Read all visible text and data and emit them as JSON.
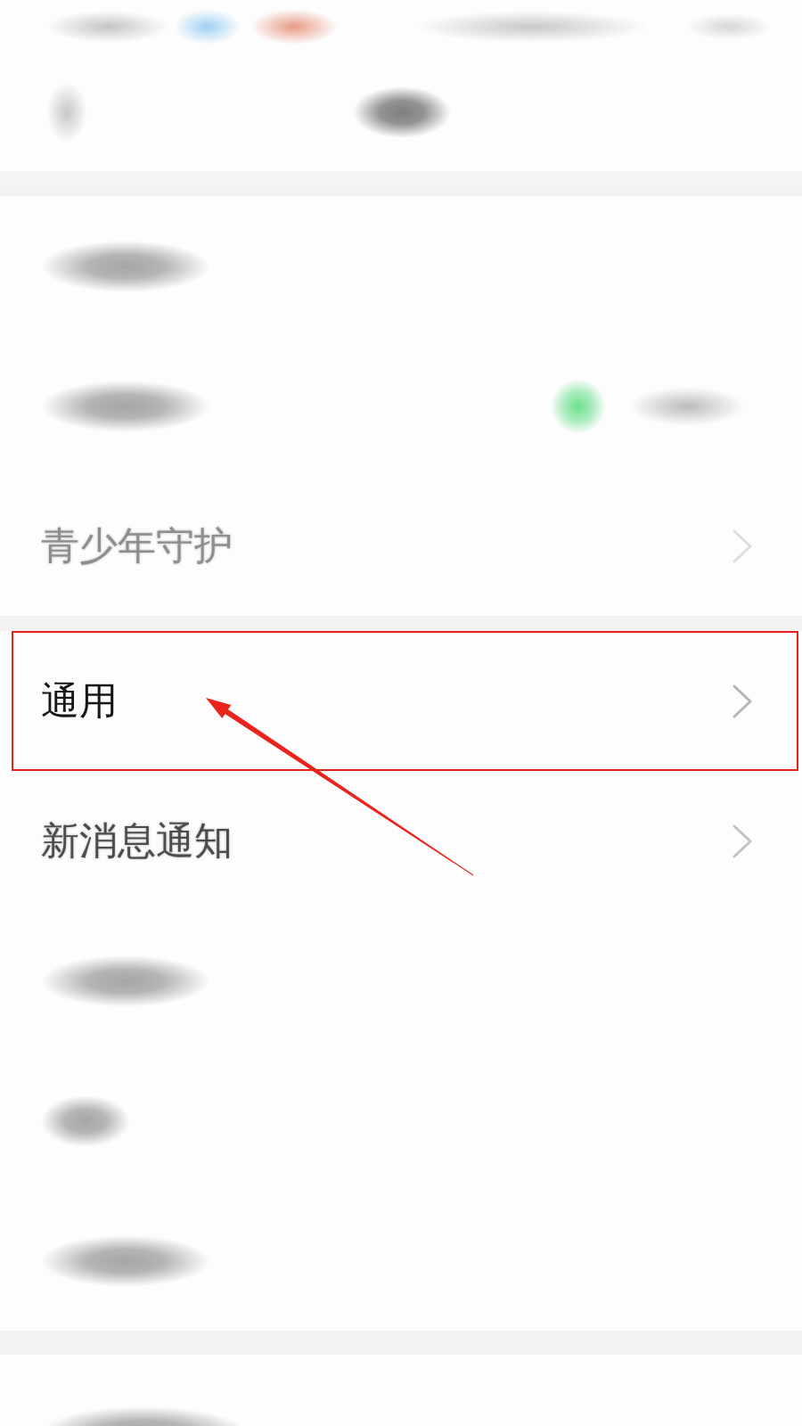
{
  "status_bar": {
    "redacted": true
  },
  "nav_bar": {
    "redacted": true
  },
  "groups": [
    {
      "rows": [
        {
          "kind": "redacted",
          "short": false,
          "highlighted": false
        },
        {
          "kind": "status",
          "short": false,
          "highlighted": false
        },
        {
          "kind": "label",
          "label": "青少年守护",
          "dimmed": true,
          "blurred": true,
          "highlighted": false
        }
      ]
    },
    {
      "rows": [
        {
          "kind": "label",
          "label": "通用",
          "dimmed": false,
          "blurred": false,
          "highlighted": true
        },
        {
          "kind": "label",
          "label": "新消息通知",
          "dimmed": false,
          "blurred": true,
          "highlighted": false
        },
        {
          "kind": "redacted",
          "short": false,
          "highlighted": false
        },
        {
          "kind": "redacted",
          "short": true,
          "highlighted": false
        },
        {
          "kind": "redacted",
          "short": false,
          "highlighted": false
        }
      ]
    },
    {
      "rows": [
        {
          "kind": "redacted",
          "short": false,
          "highlighted": false
        }
      ]
    }
  ]
}
